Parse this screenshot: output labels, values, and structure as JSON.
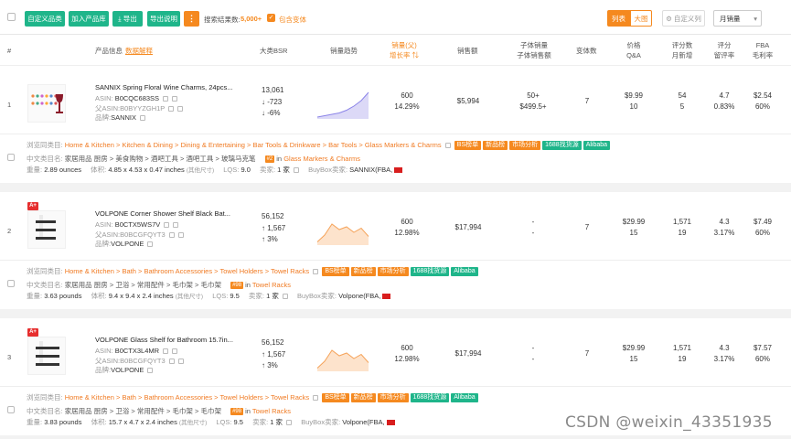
{
  "toolbar": {
    "btn_custom_products": "自定义品类",
    "btn_add_library": "加入产品库",
    "btn_export": "导出",
    "btn_export_desc": "导出说明",
    "btn_more": "⋮",
    "result_label": "搜索结果数:",
    "result_count": "5,000+",
    "include_variants": "包含变体",
    "view_list": "列表",
    "view_grid": "大图",
    "custom_columns": "自定义列",
    "sort_select": "月销量"
  },
  "header": {
    "idx": "#",
    "product_info": "产品信息",
    "data_explain": "数据解释",
    "bsr": "大类BSR",
    "sales_trend": "销量趋势",
    "sales_qty": "销量(父)",
    "growth_rate": "增长率",
    "sales_amount": "销售额",
    "child_sales": "子体销量",
    "child_sales_amount": "子体销售额",
    "variants": "变体数",
    "price": "价格",
    "qa": "Q&A",
    "reviews": "评分数",
    "monthly_new": "月新增",
    "rating": "评分",
    "retention": "留评率",
    "fba": "FBA",
    "gross_margin": "毛利率"
  },
  "rows": [
    {
      "idx": "1",
      "aplus": "",
      "title": "SANNIX Spring Floral Wine Charms, 24pcs...",
      "asin_label": "ASIN:",
      "asin": "B0CQC683SS",
      "parent_label": "父ASIN:",
      "parent": "B0BYYZGH1P",
      "brand_label": "品牌:",
      "brand": "SANNIX",
      "bsr": "13,061",
      "bsr_change": "↓ -723",
      "bsr_pct": "↓ -6%",
      "bsr_dir": "down",
      "sales": "600",
      "growth": "14.29%",
      "amount": "$5,994",
      "child_sales": "50+",
      "child_amount": "$499.5+",
      "variants": "7",
      "price": "$9.99",
      "qa": "10",
      "reviews": "54",
      "new_reviews": "5",
      "rating": "4.7",
      "retention": "0.83%",
      "fba": "$2.54",
      "margin": "60%",
      "trend": [
        20,
        19,
        18,
        17,
        15,
        12,
        8,
        2
      ],
      "crumb_label": "浏览同类目:",
      "crumbs": [
        "Home & Kitchen",
        "Kitchen & Dining",
        "Dining & Entertaining",
        "Bar Tools & Drinkware",
        "Bar Tools",
        "Glass Markers & Charms"
      ],
      "tags": [
        "BS榜单",
        "新品榜",
        "市场分析",
        "1688找货源",
        "Alibaba"
      ],
      "cn_label": "中文类目名:",
      "cn_cat": "家居用品 厨房 > 美食购物 > 酒吧工具 > 酒吧工具 > 玻璃马克笔",
      "rank_badge": "#2",
      "rank_in": "in",
      "rank_cat": "Glass Markers & Charms",
      "weight_label": "重量:",
      "weight": "2.89 ounces",
      "size_label": "体积:",
      "size": "4.85 x 4.53 x 0.47 inches",
      "size_note": "(其他尺寸)",
      "lqs_label": "LQS:",
      "lqs": "9.0",
      "seller_label": "卖家:",
      "seller": "1 家",
      "buybox_label": "BuyBox卖家:",
      "buybox": "SANNIX(FBA,"
    },
    {
      "idx": "2",
      "aplus": "A+",
      "title": "VOLPONE Corner Shower Shelf Black Bat...",
      "asin_label": "ASIN:",
      "asin": "B0CTX5WS7V",
      "parent_label": "父ASIN:",
      "parent": "B0BCGFQYT3",
      "brand_label": "品牌:",
      "brand": "VOLPONE",
      "bsr": "56,152",
      "bsr_change": "↑ 1,567",
      "bsr_pct": "↑ 3%",
      "bsr_dir": "up",
      "sales": "600",
      "growth": "12.98%",
      "amount": "$17,994",
      "child_sales": "-",
      "child_amount": "-",
      "variants": "7",
      "price": "$29.99",
      "qa": "15",
      "reviews": "1,571",
      "new_reviews": "19",
      "rating": "4.3",
      "retention": "3.17%",
      "fba": "$7.49",
      "margin": "60%",
      "trend": [
        19,
        14,
        6,
        10,
        8,
        12,
        9,
        15
      ],
      "crumb_label": "浏览同类目:",
      "crumbs": [
        "Home & Kitchen",
        "Bath",
        "Bathroom Accessories",
        "Towel Holders",
        "Towel Racks"
      ],
      "tags": [
        "BS榜单",
        "新品榜",
        "市场分析",
        "1688找货源",
        "Alibaba"
      ],
      "cn_label": "中文类目名:",
      "cn_cat": "家居用品 厨房 > 卫浴 > 常用配件 > 毛巾架 > 毛巾架",
      "rank_badge": "#98",
      "rank_in": "in",
      "rank_cat": "Towel Racks",
      "weight_label": "重量:",
      "weight": "3.63 pounds",
      "size_label": "体积:",
      "size": "9.4 x 9.4 x 2.4 inches",
      "size_note": "(其他尺寸)",
      "lqs_label": "LQS:",
      "lqs": "9.5",
      "seller_label": "卖家:",
      "seller": "1 家",
      "buybox_label": "BuyBox卖家:",
      "buybox": "Volpone(FBA,"
    },
    {
      "idx": "3",
      "aplus": "A+",
      "title": "VOLPONE Glass Shelf for Bathroom 15.7in...",
      "asin_label": "ASIN:",
      "asin": "B0CTX3L4MR",
      "parent_label": "父ASIN:",
      "parent": "B0BCGFQYT3",
      "brand_label": "品牌:",
      "brand": "VOLPONE",
      "bsr": "56,152",
      "bsr_change": "↑ 1,567",
      "bsr_pct": "↑ 3%",
      "bsr_dir": "up",
      "sales": "600",
      "growth": "12.98%",
      "amount": "$17,994",
      "child_sales": "-",
      "child_amount": "-",
      "variants": "7",
      "price": "$29.99",
      "qa": "15",
      "reviews": "1,571",
      "new_reviews": "19",
      "rating": "4.3",
      "retention": "3.17%",
      "fba": "$7.57",
      "margin": "60%",
      "trend": [
        19,
        14,
        6,
        10,
        8,
        12,
        9,
        15
      ],
      "crumb_label": "浏览同类目:",
      "crumbs": [
        "Home & Kitchen",
        "Bath",
        "Bathroom Accessories",
        "Towel Holders",
        "Towel Racks"
      ],
      "tags": [
        "BS榜单",
        "新品榜",
        "市场分析",
        "1688找货源",
        "Alibaba"
      ],
      "cn_label": "中文类目名:",
      "cn_cat": "家居用品 厨房 > 卫浴 > 常用配件 > 毛巾架 > 毛巾架",
      "rank_badge": "#98",
      "rank_in": "in",
      "rank_cat": "Towel Racks",
      "weight_label": "重量:",
      "weight": "3.83 pounds",
      "size_label": "体积:",
      "size": "15.7 x 4.7 x 2.4 inches",
      "size_note": "(其他尺寸)",
      "lqs_label": "LQS:",
      "lqs": "9.5",
      "seller_label": "卖家:",
      "seller": "1 家",
      "buybox_label": "BuyBox卖家:",
      "buybox": "Volpone(FBA,"
    }
  ],
  "watermark": "CSDN @weixin_43351935",
  "colors": {
    "accent": "#f5891f",
    "green": "#1fb58a",
    "up": "#1aa06d",
    "down": "#e02020"
  }
}
